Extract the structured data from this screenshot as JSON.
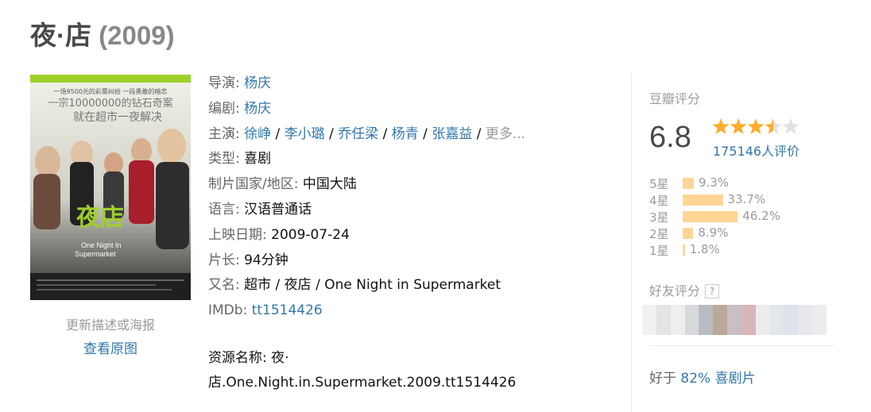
{
  "header": {
    "title": "夜·店",
    "year": "(2009)"
  },
  "poster": {
    "tagline_1": "一场9500元的彩票纠纷 一段勇敢的暗恋",
    "tagline_2": "一宗10000000的钻石奇案",
    "tagline_3": "就在超市一夜解决",
    "title_cn": "夜店",
    "title_en_1": "One Night In",
    "title_en_2": "Supermarket",
    "update_link": "更新描述或海报",
    "view_link": "查看原图"
  },
  "info": {
    "director_label": "导演",
    "director": "杨庆",
    "writer_label": "编剧",
    "writer": "杨庆",
    "cast_label": "主演",
    "cast": [
      "徐峥",
      "李小璐",
      "乔任梁",
      "杨青",
      "张嘉益"
    ],
    "cast_more": "更多...",
    "genre_label": "类型",
    "genre": "喜剧",
    "country_label": "制片国家/地区",
    "country": "中国大陆",
    "language_label": "语言",
    "language": "汉语普通话",
    "release_label": "上映日期",
    "release": "2009-07-24",
    "runtime_label": "片长",
    "runtime": "94分钟",
    "aka_label": "又名",
    "aka": "超市 / 夜店 / One Night in Supermarket",
    "imdb_label": "IMDb",
    "imdb": "tt1514426",
    "resource_label": "资源名称:",
    "resource_value": "夜·店.One.Night.in.Supermarket.2009.tt1514426"
  },
  "rating": {
    "title": "豆瓣评分",
    "score": "6.8",
    "stars": 3.5,
    "votes": "175146人评价",
    "distribution": [
      {
        "label": "5星",
        "percent": 9.3,
        "text": "9.3%"
      },
      {
        "label": "4星",
        "percent": 33.7,
        "text": "33.7%"
      },
      {
        "label": "3星",
        "percent": 46.2,
        "text": "46.2%"
      },
      {
        "label": "2星",
        "percent": 8.9,
        "text": "8.9%"
      },
      {
        "label": "1星",
        "percent": 1.8,
        "text": "1.8%"
      }
    ],
    "friend_title": "好友评分",
    "help_glyph": "?",
    "better_prefix": "好于",
    "better_link": "82% 喜剧片"
  },
  "colors": {
    "link": "#3377aa",
    "star": "#ffac2d",
    "star_empty": "#e0e0e0",
    "bar": "#ffd596",
    "poster_band": "#9fd02a"
  }
}
